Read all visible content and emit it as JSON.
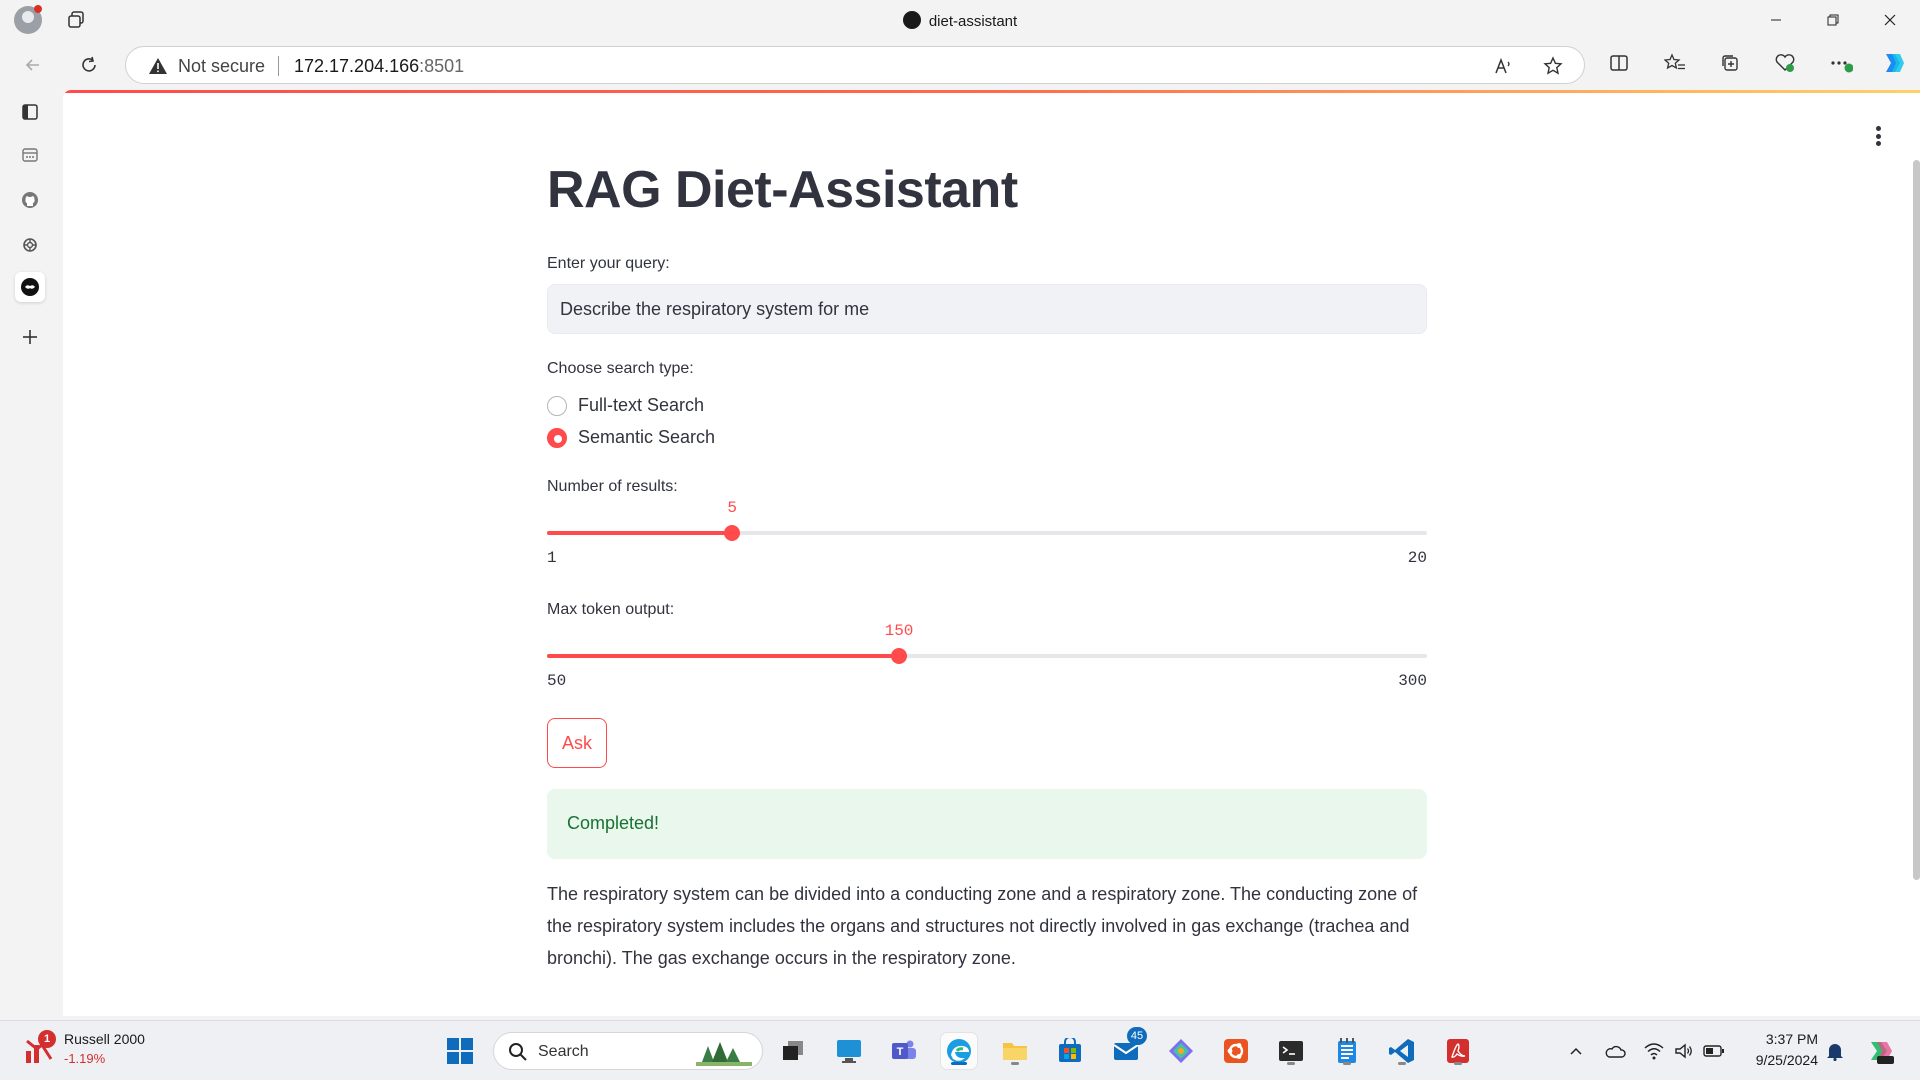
{
  "browser": {
    "window_title": "diet-assistant",
    "security_label": "Not secure",
    "url_host": "172.17.204.166",
    "url_port": ":8501"
  },
  "app": {
    "title": "RAG Diet-Assistant",
    "query": {
      "label": "Enter your query:",
      "value": "Describe the respiratory system for me"
    },
    "search_type": {
      "label": "Choose search type:",
      "options": [
        "Full-text Search",
        "Semantic Search"
      ],
      "selected": "Semantic Search"
    },
    "results_slider": {
      "label": "Number of results:",
      "value": "5",
      "min": "1",
      "max": "20",
      "fraction": 0.2105
    },
    "tokens_slider": {
      "label": "Max token output:",
      "value": "150",
      "min": "50",
      "max": "300",
      "fraction": 0.4
    },
    "ask_button": "Ask",
    "status": "Completed!",
    "answer": "The respiratory system can be divided into a conducting zone and a respiratory zone. The conducting zone of the respiratory system includes the organs and structures not directly involved in gas exchange (trachea and bronchi). The gas exchange occurs in the respiratory zone."
  },
  "taskbar": {
    "widget_badge": "1",
    "stock_name": "Russell 2000",
    "stock_change": "-1.19%",
    "search_label": "Search",
    "mail_badge": "45",
    "time": "3:37 PM",
    "date": "9/25/2024"
  },
  "colors": {
    "accent": "#ff4b4b",
    "success_bg": "#e9f7ed",
    "success_text": "#177233",
    "input_bg": "#f0f2f6"
  }
}
